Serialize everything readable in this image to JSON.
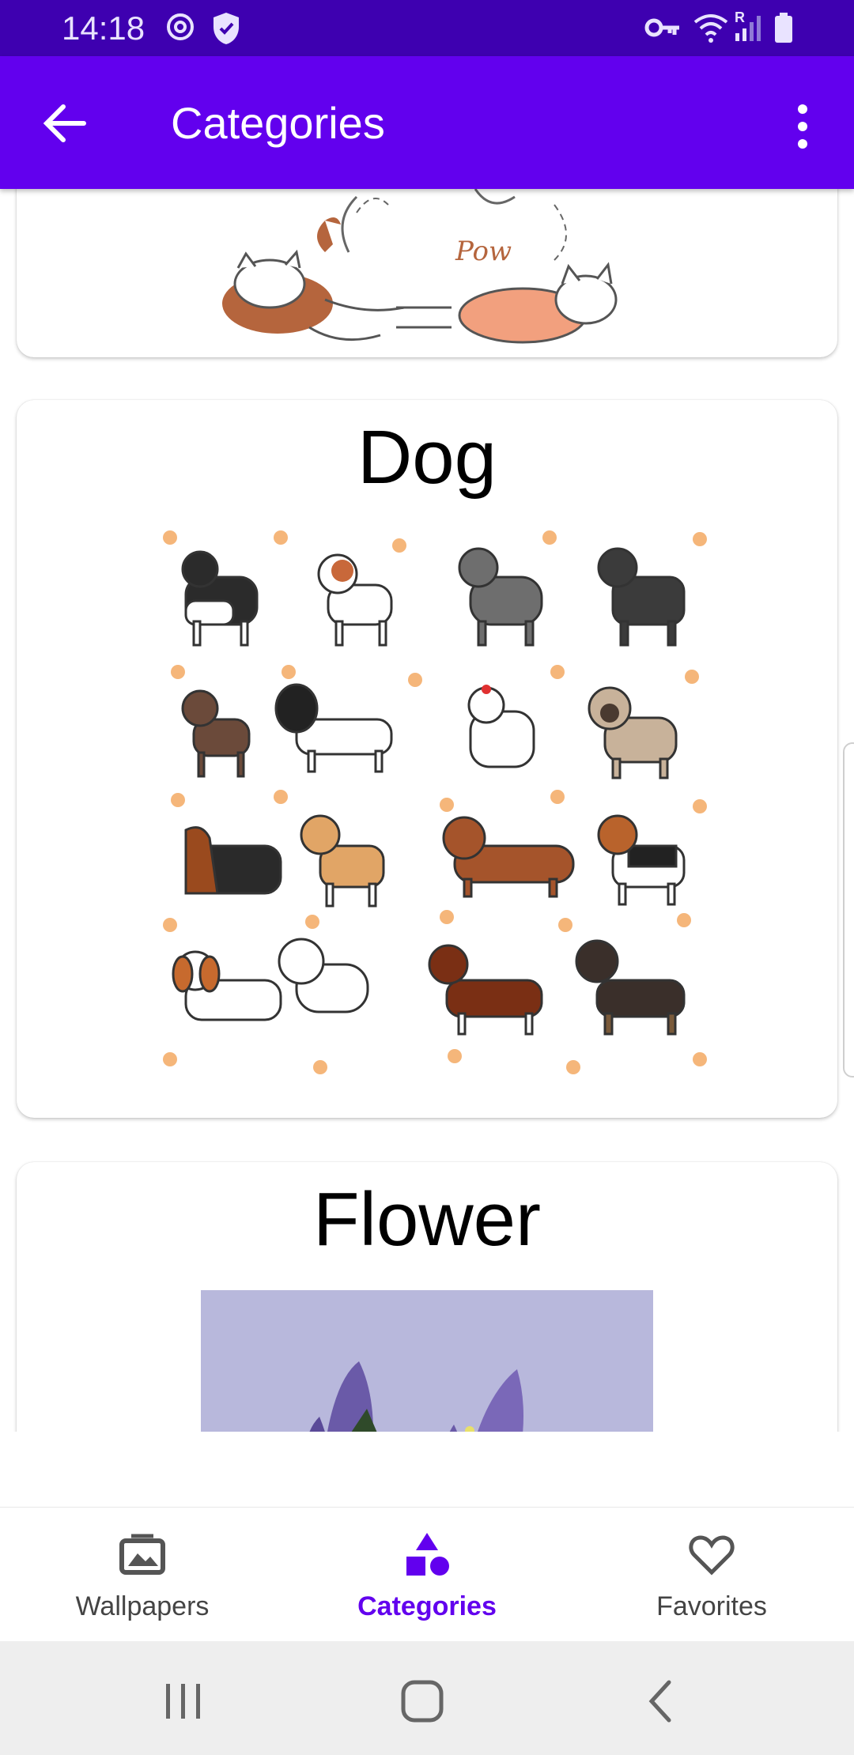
{
  "status": {
    "time": "14:18",
    "network_label": "R"
  },
  "appbar": {
    "title": "Categories"
  },
  "categories": [
    {
      "label": "Dog"
    },
    {
      "label": "Flower"
    }
  ],
  "nav": {
    "items": [
      {
        "label": "Wallpapers",
        "icon": "image-icon",
        "active": false
      },
      {
        "label": "Categories",
        "icon": "shapes-icon",
        "active": true
      },
      {
        "label": "Favorites",
        "icon": "heart-icon",
        "active": false
      }
    ]
  },
  "colors": {
    "status_bar": "#3e00b0",
    "app_bar": "#6200ee",
    "accent": "#6200ee",
    "flower_bg": "#b8b8dc"
  }
}
